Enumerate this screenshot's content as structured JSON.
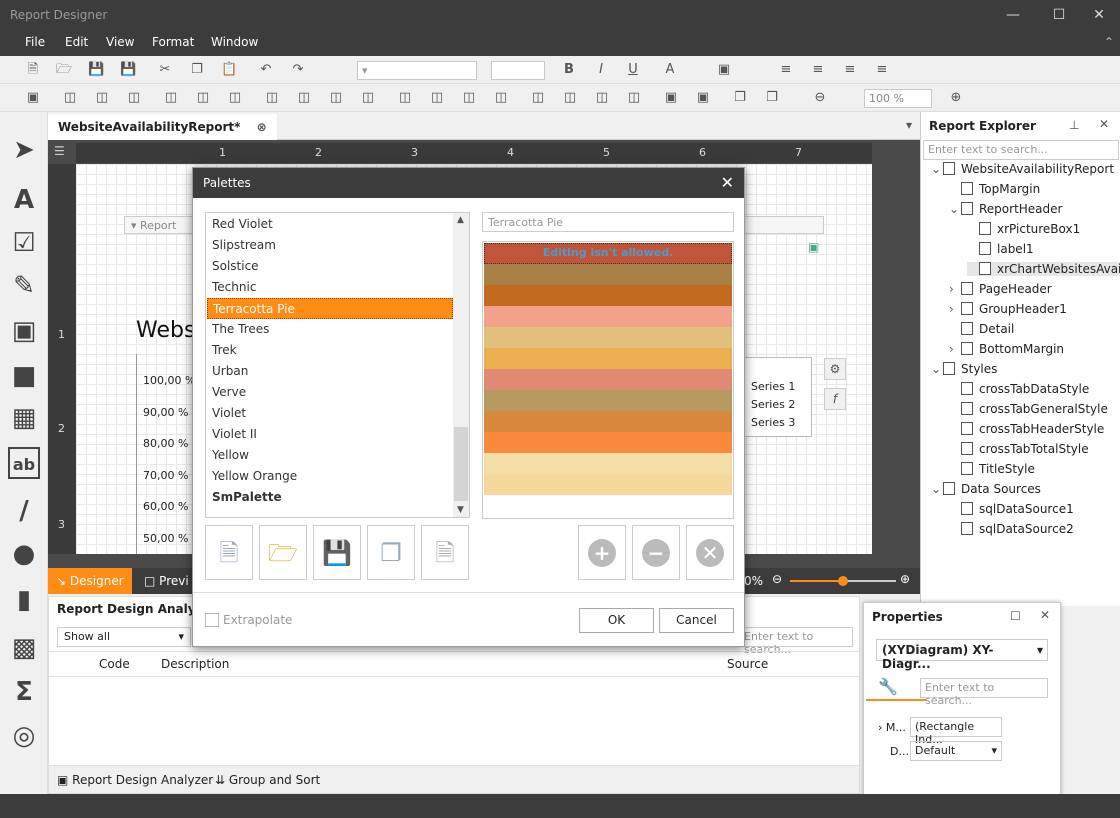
{
  "app": {
    "title": "Report Designer"
  },
  "menu": [
    "File",
    "Edit",
    "View",
    "Format",
    "Window"
  ],
  "toolbar": {
    "zoom": "100 %"
  },
  "document": {
    "tab_label": "WebsiteAvailabilityReport*"
  },
  "canvas": {
    "ruler_marks": [
      "1",
      "2",
      "3",
      "4",
      "5",
      "6",
      "7"
    ],
    "vruler_marks": [
      "1",
      "2",
      "3"
    ],
    "report_title": "Webs",
    "report_label": "Report",
    "y_ticks": [
      "100,00 %",
      "90,00 %",
      "80,00 %",
      "70,00 %",
      "60,00 %",
      "50,00 %"
    ],
    "legend": [
      "Series 1",
      "Series 2",
      "Series 3"
    ]
  },
  "bottom_tabs": {
    "designer": "Designer",
    "preview": "Previ",
    "zoom_pct": "0%"
  },
  "analyzer": {
    "title": "Report Design Analyzer",
    "filter": "Show all",
    "search_placeholder": "Enter text to search...",
    "columns": [
      "Code",
      "Description",
      "Source"
    ],
    "tabs": [
      "Report Design Analyzer",
      "Group and Sort"
    ]
  },
  "explorer": {
    "title": "Report Explorer",
    "search_placeholder": "Enter text to search...",
    "items": [
      {
        "label": "WebsiteAvailabilityReport",
        "level": 0
      },
      {
        "label": "TopMargin",
        "level": 1
      },
      {
        "label": "ReportHeader",
        "level": 1
      },
      {
        "label": "xrPictureBox1",
        "level": 2
      },
      {
        "label": "label1",
        "level": 2
      },
      {
        "label": "xrChartWebsitesAvail...",
        "level": 2
      },
      {
        "label": "PageHeader",
        "level": 1
      },
      {
        "label": "GroupHeader1",
        "level": 1
      },
      {
        "label": "Detail",
        "level": 1
      },
      {
        "label": "BottomMargin",
        "level": 1
      },
      {
        "label": "Styles",
        "level": 0
      },
      {
        "label": "crossTabDataStyle",
        "level": 1
      },
      {
        "label": "crossTabGeneralStyle",
        "level": 1
      },
      {
        "label": "crossTabHeaderStyle",
        "level": 1
      },
      {
        "label": "crossTabTotalStyle",
        "level": 1
      },
      {
        "label": "TitleStyle",
        "level": 1
      },
      {
        "label": "Data Sources",
        "level": 0
      },
      {
        "label": "sqlDataSource1",
        "level": 1
      },
      {
        "label": "sqlDataSource2",
        "level": 1
      }
    ]
  },
  "properties": {
    "title": "Properties",
    "selector": "(XYDiagram)   XY-Diagr...",
    "search_placeholder": "Enter text to search...",
    "rows": [
      {
        "name": "M...",
        "value": "(Rectangle Ind..."
      },
      {
        "name": "D...",
        "value": "Default"
      }
    ]
  },
  "dialog": {
    "title": "Palettes",
    "palettes": [
      "Red Violet",
      "Slipstream",
      "Solstice",
      "Technic",
      "Terracotta Pie",
      "The Trees",
      "Trek",
      "Urban",
      "Verve",
      "Violet",
      "Violet II",
      "Yellow",
      "Yellow Orange",
      "SmPalette"
    ],
    "selected_index": 4,
    "name_field": "Terracotta Pie",
    "no_edit": "Editing isn't allowed.",
    "swatches": [
      "#c0553a",
      "#a88045",
      "#c26a1e",
      "#f0a38a",
      "#e2c07c",
      "#ebb050",
      "#e08a72",
      "#b79a62",
      "#d8893d",
      "#fb8a3d",
      "#f3dea8",
      "#f6d99a"
    ],
    "extrapolate": "Extrapolate",
    "ok": "OK",
    "cancel": "Cancel"
  }
}
